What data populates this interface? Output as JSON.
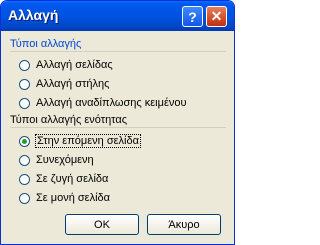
{
  "window": {
    "title": "Αλλαγή",
    "help_glyph": "?",
    "close_glyph": "✕"
  },
  "break_types": {
    "heading": "Τύποι αλλαγής",
    "options": [
      {
        "label": "Αλλαγή σελίδας",
        "selected": false
      },
      {
        "label": "Αλλαγή στήλης",
        "selected": false
      },
      {
        "label": "Αλλαγή αναδίπλωσης κειμένου",
        "selected": false
      }
    ]
  },
  "section_break_types": {
    "heading": "Τύποι αλλαγής ενότητας",
    "options": [
      {
        "label": "Στην επόμενη σελίδα",
        "selected": true
      },
      {
        "label": "Συνεχόμενη",
        "selected": false
      },
      {
        "label": "Σε ζυγή σελίδα",
        "selected": false
      },
      {
        "label": "Σε μονή σελίδα",
        "selected": false
      }
    ]
  },
  "buttons": {
    "ok": "OK",
    "cancel": "Άκυρο"
  },
  "colors": {
    "group_heading": "#0046d5",
    "selected_radio": "#21a121"
  }
}
